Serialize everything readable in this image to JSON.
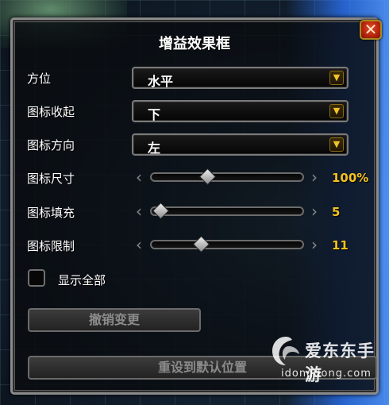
{
  "frame": {
    "title": "增益效果框",
    "close_label": "✕"
  },
  "rows": {
    "position": {
      "label": "方位",
      "value": "水平"
    },
    "collapse": {
      "label": "图标收起",
      "value": "下"
    },
    "direction": {
      "label": "图标方向",
      "value": "左"
    },
    "size": {
      "label": "图标尺寸",
      "value_text": "100%",
      "fraction": 0.36
    },
    "fill": {
      "label": "图标填充",
      "value_text": "5",
      "fraction": 0.04
    },
    "limit": {
      "label": "图标限制",
      "value_text": "11",
      "fraction": 0.32
    }
  },
  "show_all": {
    "label": "显示全部",
    "checked": false
  },
  "buttons": {
    "revert": "撤销变更",
    "reset": "重设到默认位置"
  },
  "watermark": {
    "brand": "爱东东手游",
    "domain": "idongdong.com"
  },
  "colors": {
    "value_gold": "#f4c21f",
    "close_red": "#c8300f",
    "disabled_text": "#8b8b8b"
  }
}
